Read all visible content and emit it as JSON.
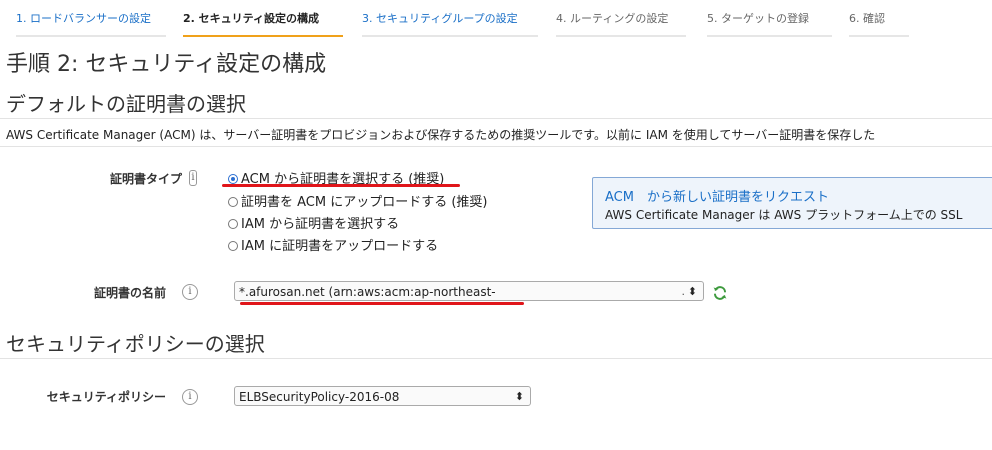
{
  "wizard": {
    "steps": [
      {
        "label": "1. ロードバランサーの設定"
      },
      {
        "label": "2. セキュリティ設定の構成"
      },
      {
        "label": "3. セキュリティグループの設定"
      },
      {
        "label": "4. ルーティングの設定"
      },
      {
        "label": "5. ターゲットの登録"
      },
      {
        "label": "6. 確認"
      }
    ],
    "active_index": 1,
    "accent_color": "#f0a11a"
  },
  "page": {
    "title": "手順 2: セキュリティ設定の構成"
  },
  "default_cert": {
    "heading": "デフォルトの証明書の選択",
    "description": "AWS Certificate Manager (ACM) は、サーバー証明書をプロビジョンおよび保存するための推奨ツールです。以前に IAM を使用してサーバー証明書を保存した",
    "cert_type_label": "証明書タイプ",
    "cert_type_options": [
      {
        "label": "ACM から証明書を選択する (推奨)",
        "checked": true
      },
      {
        "label": "証明書を ACM にアップロードする (推奨)",
        "checked": false
      },
      {
        "label": "IAM から証明書を選択する",
        "checked": false
      },
      {
        "label": "IAM に証明書をアップロードする",
        "checked": false
      }
    ],
    "info_box": {
      "link": "ACM　から新しい証明書をリクエスト",
      "text": "AWS Certificate Manager は AWS プラットフォーム上での SSL"
    },
    "cert_name_label": "証明書の名前",
    "cert_name_value": "*.afurosan.net (arn:aws:acm:ap-northeast-",
    "cert_name_ellipsis": ".",
    "refresh_icon": "refresh-icon"
  },
  "security_policy": {
    "heading": "セキュリティポリシーの選択",
    "label": "セキュリティポリシー",
    "value": "ELBSecurityPolicy-2016-08"
  },
  "colors": {
    "link": "#1a6fc7",
    "annotation": "#e0151a",
    "info_border": "#84a8d6",
    "info_bg": "#eef4fb"
  }
}
